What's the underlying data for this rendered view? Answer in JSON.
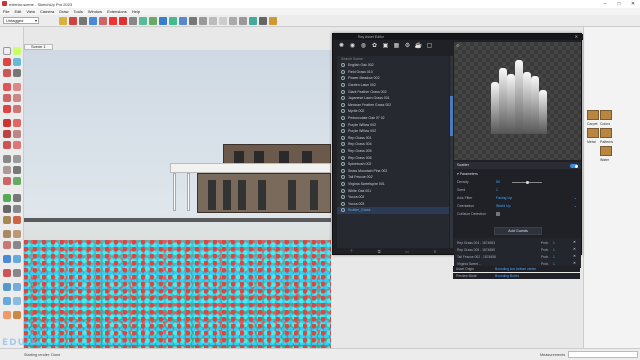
{
  "window": {
    "title": "exterior.scene - SketchUp Pro 2023"
  },
  "menu": [
    "File",
    "Edit",
    "View",
    "Camera",
    "Draw",
    "Tools",
    "Window",
    "Extensions",
    "Help"
  ],
  "tag_selector": {
    "value": "Untagged"
  },
  "scene_tab": "Scene 1",
  "ray_panel": {
    "title": "Ray Asset Editor",
    "search_placeholder": "Search Scene",
    "list_items": [
      "English Oak 002",
      "Field Grass 010",
      "Flower Meadow 002",
      "Garden Lawn 002",
      "Giant Feather Grass 002",
      "Japanese Lawn Grass 001",
      "Mexican Feather Grass 002",
      "Myrtle 002",
      "Pedunculate Oak 07 02",
      "Purple Willow 002",
      "Purple Willow 002",
      "Rep Grass 001",
      "Rep Grass 004",
      "Rep Grass 005",
      "Rep Grass 006",
      "Spinebush 002",
      "Swiss Mountain Pine 002",
      "Tall Fescue 002",
      "Virginia Sweetspire 001",
      "White Oak 001",
      "Yucca 002",
      "Yucca 003",
      "Scatter_Grass"
    ],
    "selected_index": 22,
    "scatter_label": "Scatter",
    "parameters_label": "Parameters",
    "params": [
      {
        "label": "Density",
        "value": "50"
      },
      {
        "label": "Seed",
        "value": "1"
      },
      {
        "label": "Axis Filter",
        "value": "Facing Up"
      },
      {
        "label": "Orientation",
        "value": "World Up"
      },
      {
        "label": "Collision Detection",
        "value": ""
      }
    ],
    "add_guests_label": "Add Guests",
    "guests": [
      {
        "name": "Rep Grass 004 - 1874653",
        "prob_label": "Prob.",
        "prob": "1"
      },
      {
        "name": "Rep Grass 005 - 1874655",
        "prob_label": "Prob.",
        "prob": "1"
      },
      {
        "name": "Tall Fescue 002 - 1874658",
        "prob_label": "Prob.",
        "prob": "1"
      },
      {
        "name": "Virginia Sweet...",
        "prob_label": "Prob.",
        "prob": "1"
      }
    ],
    "bottom_rows": [
      {
        "label": "Asset Origin",
        "value": "Bounding box bottom center"
      },
      {
        "label": "Preview Mode",
        "value": "Bounding Boxes"
      }
    ]
  },
  "materials": [
    "Carpet",
    "Colors",
    "Metal",
    "Patterns",
    "Water"
  ],
  "status": {
    "message": "Starting render: Done",
    "measurements_label": "Measurements"
  },
  "watermark": "EDUIX"
}
